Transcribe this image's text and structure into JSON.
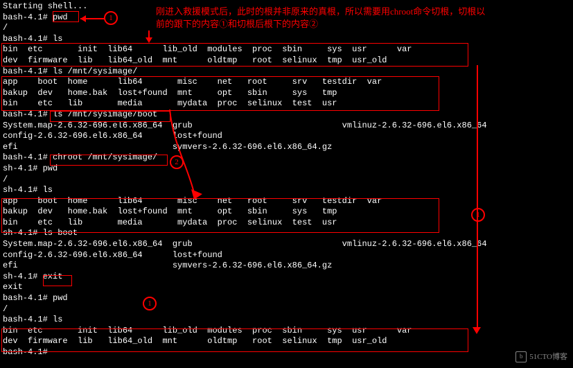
{
  "annotation": {
    "text": "刚进入救援模式后，此时的根并非原来的真根，所以需要用chroot命令切根，切根以前的跟下的内容①和切根后根下的内容②"
  },
  "term": [
    "Starting shell...",
    "bash-4.1# pwd",
    "/",
    "bash-4.1# ls",
    "bin  etc       init  lib64      lib_old  modules  proc  sbin     sys  usr      var",
    "dev  firmware  lib   lib64_old  mnt      oldtmp   root  selinux  tmp  usr_old",
    "bash-4.1# ls /mnt/sysimage/",
    "app    boot  home      lib64       misc    net   root     srv   testdir  var",
    "bakup  dev   home.bak  lost+found  mnt     opt   sbin     sys   tmp",
    "bin    etc   lib       media       mydata  proc  selinux  test  usr",
    "bash-4.1# ls /mnt/sysimage/boot",
    "System.map-2.6.32-696.el6.x86_64  grub        symvers-2.6.32-696.el6.x86_64.gz",
    "config-2.6.32-696.el6.x86_64      lost+found  vmlinuz-2.6.32-696.el6.x86_64",
    "efi                               symvers-2.6.32-696.el6.x86_64.gz",
    "bash-4.1# chroot /mnt/sysimage/",
    "sh-4.1# pwd",
    "/",
    "sh-4.1# ls",
    "app    boot  home      lib64       misc    net   root     srv   testdir  var",
    "bakup  dev   home.bak  lost+found  mnt     opt   sbin     sys   tmp",
    "bin    etc   lib       media       mydata  proc  selinux  test  usr",
    "sh-4.1# ls boot",
    "System.map-2.6.32-696.el6.x86_64  grub        symvers-2.6.32-696.el6.x86_64.gz  vmlinuz-2.6.32-696.el6.x86_64",
    "config-2.6.32-696.el6.x86_64      lost+found",
    "efi                               symvers-2.6.32-696.el6.x86_64.gz",
    "sh-4.1# exit",
    "exit",
    "bash-4.1# pwd",
    "/",
    "bash-4.1# ls",
    "bin  etc       init  lib64      lib_old  modules  proc  sbin     sys  usr      var",
    "dev  firmware  lib   lib64_old  mnt      oldtmp   root  selinux  tmp  usr_old",
    "bash-4.1#"
  ],
  "term_display": {
    "l0": "Starting shell...",
    "l1": "bash-4.1# pwd",
    "l2": "/",
    "l3": "bash-4.1# ls",
    "l4": "bin  etc       init  lib64      lib_old  modules  proc  sbin     sys  usr      var",
    "l5": "dev  firmware  lib   lib64_old  mnt      oldtmp   root  selinux  tmp  usr_old",
    "l6": "bash-4.1# ls /mnt/sysimage/",
    "l7": "app    boot  home      lib64       misc    net   root     srv   testdir  var",
    "l8": "bakup  dev   home.bak  lost+found  mnt     opt   sbin     sys   tmp",
    "l9": "bin    etc   lib       media       mydata  proc  selinux  test  usr",
    "l10": "bash-4.1# ls /mnt/sysimage/boot",
    "l11": "System.map-2.6.32-696.el6.x86_64  grub                              vmlinuz-2.6.32-696.el6.x86_64",
    "l12": "config-2.6.32-696.el6.x86_64      lost+found",
    "l13": "efi                               symvers-2.6.32-696.el6.x86_64.gz",
    "l14": "bash-4.1# chroot /mnt/sysimage/",
    "l15": "sh-4.1# pwd",
    "l16": "/",
    "l17": "sh-4.1# ls",
    "l18": "app    boot  home      lib64       misc    net   root     srv   testdir  var",
    "l19": "bakup  dev   home.bak  lost+found  mnt     opt   sbin     sys   tmp",
    "l20": "bin    etc   lib       media       mydata  proc  selinux  test  usr",
    "l21": "sh-4.1# ls boot",
    "l22": "System.map-2.6.32-696.el6.x86_64  grub                              vmlinuz-2.6.32-696.el6.x86_64",
    "l23": "config-2.6.32-696.el6.x86_64      lost+found",
    "l24": "efi                               symvers-2.6.32-696.el6.x86_64.gz",
    "l25": "sh-4.1# exit",
    "l26": "exit",
    "l27": "bash-4.1# pwd",
    "l28": "/",
    "l29": "bash-4.1# ls",
    "l30": "bin  etc       init  lib64      lib_old  modules  proc  sbin     sys  usr      var",
    "l31": "dev  firmware  lib   lib64_old  mnt      oldtmp   root  selinux  tmp  usr_old",
    "l32": "bash-4.1#"
  },
  "watermark": "51CTO博客",
  "circles": {
    "c1": "1",
    "c2": "2"
  }
}
